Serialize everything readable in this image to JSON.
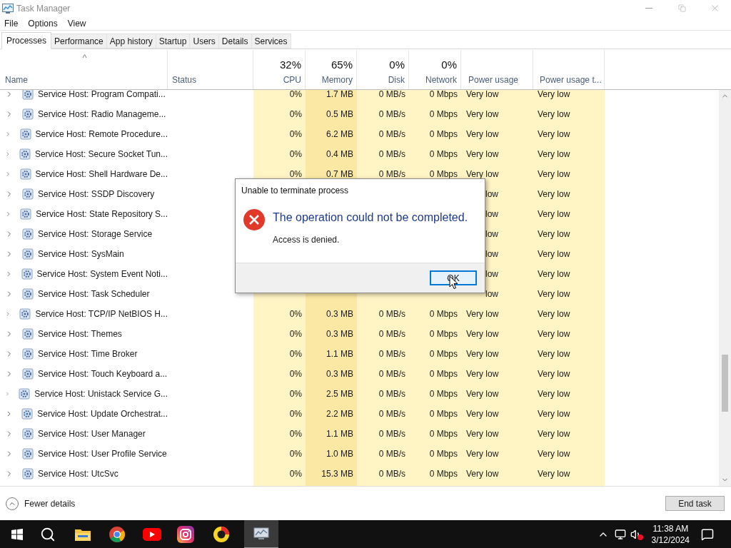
{
  "window": {
    "title": "Task Manager"
  },
  "menu": [
    "File",
    "Options",
    "View"
  ],
  "tabs": [
    {
      "label": "Processes",
      "selected": true
    },
    {
      "label": "Performance",
      "selected": false
    },
    {
      "label": "App history",
      "selected": false
    },
    {
      "label": "Startup",
      "selected": false
    },
    {
      "label": "Users",
      "selected": false
    },
    {
      "label": "Details",
      "selected": false
    },
    {
      "label": "Services",
      "selected": false
    }
  ],
  "columns": {
    "name": "Name",
    "status": "Status",
    "cpu": {
      "percent": "32%",
      "label": "CPU"
    },
    "memory": {
      "percent": "65%",
      "label": "Memory"
    },
    "disk": {
      "percent": "0%",
      "label": "Disk"
    },
    "network": {
      "percent": "0%",
      "label": "Network"
    },
    "power": "Power usage",
    "power_trend": "Power usage t..."
  },
  "sort_indicator": "^",
  "rows": [
    {
      "name": "Service Host: Program Compati...",
      "cpu": "0%",
      "memory": "1.7 MB",
      "disk": "0 MB/s",
      "network": "0 Mbps",
      "power": "Very low",
      "power_trend": "Very low"
    },
    {
      "name": "Service Host: Radio Manageme...",
      "cpu": "0%",
      "memory": "0.5 MB",
      "disk": "0 MB/s",
      "network": "0 Mbps",
      "power": "Very low",
      "power_trend": "Very low"
    },
    {
      "name": "Service Host: Remote Procedure...",
      "cpu": "0%",
      "memory": "6.2 MB",
      "disk": "0 MB/s",
      "network": "0 Mbps",
      "power": "Very low",
      "power_trend": "Very low"
    },
    {
      "name": "Service Host: Secure Socket Tun...",
      "cpu": "0%",
      "memory": "0.4 MB",
      "disk": "0 MB/s",
      "network": "0 Mbps",
      "power": "Very low",
      "power_trend": "Very low"
    },
    {
      "name": "Service Host: Shell Hardware De...",
      "cpu": "0%",
      "memory": "0.7 MB",
      "disk": "0 MB/s",
      "network": "0 Mbps",
      "power": "Very low",
      "power_trend": "Very low"
    },
    {
      "name": "Service Host: SSDP Discovery",
      "power": "low",
      "power_trend": "Very low"
    },
    {
      "name": "Service Host: State Repository S...",
      "power": "low",
      "power_trend": "Very low"
    },
    {
      "name": "Service Host: Storage Service",
      "power": "low",
      "power_trend": "Very low"
    },
    {
      "name": "Service Host: SysMain",
      "power": "low",
      "power_trend": "Very low"
    },
    {
      "name": "Service Host: System Event Noti...",
      "power": "low",
      "power_trend": "Very low"
    },
    {
      "name": "Service Host: Task Scheduler",
      "power": "low",
      "power_trend": "Very low"
    },
    {
      "name": "Service Host: TCP/IP NetBIOS H...",
      "cpu": "0%",
      "memory": "0.3 MB",
      "disk": "0 MB/s",
      "network": "0 Mbps",
      "power": "Very low",
      "power_trend": "Very low"
    },
    {
      "name": "Service Host: Themes",
      "cpu": "0%",
      "memory": "0.3 MB",
      "disk": "0 MB/s",
      "network": "0 Mbps",
      "power": "Very low",
      "power_trend": "Very low"
    },
    {
      "name": "Service Host: Time Broker",
      "cpu": "0%",
      "memory": "1.1 MB",
      "disk": "0 MB/s",
      "network": "0 Mbps",
      "power": "Very low",
      "power_trend": "Very low"
    },
    {
      "name": "Service Host: Touch Keyboard a...",
      "cpu": "0%",
      "memory": "0.3 MB",
      "disk": "0 MB/s",
      "network": "0 Mbps",
      "power": "Very low",
      "power_trend": "Very low"
    },
    {
      "name": "Service Host: Unistack Service G...",
      "cpu": "0%",
      "memory": "2.5 MB",
      "disk": "0 MB/s",
      "network": "0 Mbps",
      "power": "Very low",
      "power_trend": "Very low"
    },
    {
      "name": "Service Host: Update Orchestrat...",
      "cpu": "0%",
      "memory": "2.2 MB",
      "disk": "0 MB/s",
      "network": "0 Mbps",
      "power": "Very low",
      "power_trend": "Very low"
    },
    {
      "name": "Service Host: User Manager",
      "cpu": "0%",
      "memory": "1.1 MB",
      "disk": "0 MB/s",
      "network": "0 Mbps",
      "power": "Very low",
      "power_trend": "Very low"
    },
    {
      "name": "Service Host: User Profile Service",
      "cpu": "0%",
      "memory": "1.0 MB",
      "disk": "0 MB/s",
      "network": "0 Mbps",
      "power": "Very low",
      "power_trend": "Very low"
    },
    {
      "name": "Service Host: UtcSvc",
      "cpu": "0%",
      "memory": "15.3 MB",
      "disk": "0 MB/s",
      "network": "0 Mbps",
      "power": "Very low",
      "power_trend": "Very low"
    }
  ],
  "dialog": {
    "title": "Unable to terminate process",
    "heading": "The operation could not be completed.",
    "message": "Access is denied.",
    "button": "OK"
  },
  "footer": {
    "fewer_details": "Fewer details",
    "end_task": "End task"
  },
  "taskbar": {
    "time": "11:38 AM",
    "date": "3/12/2024"
  }
}
